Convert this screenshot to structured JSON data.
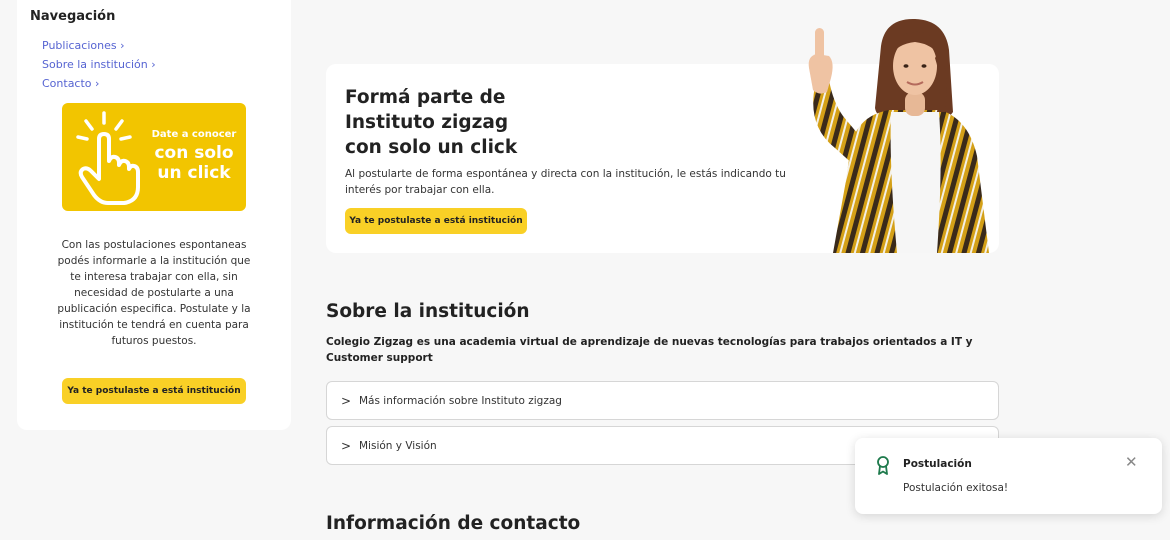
{
  "sidebar": {
    "title": "Navegación",
    "links": [
      {
        "label": "Publicaciones ›"
      },
      {
        "label": "Sobre la institución ›"
      },
      {
        "label": "Contacto ›"
      }
    ],
    "promo": {
      "line1": "Date a conocer",
      "line2": "con solo",
      "line3": "un click"
    },
    "description": "Con las postulaciones espontaneas podés informarle a la institución que te interesa trabajar con ella, sin necesidad de postularte a una publicación especifica. Postulate y la institución te tendrá en cuenta para futuros puestos.",
    "button_label": "Ya te postulaste a está institución"
  },
  "hero": {
    "title_lines": [
      "Formá parte de",
      "Instituto zigzag",
      "con solo un click"
    ],
    "description": "Al postularte de forma espontánea y directa con la institución, le estás indicando tu interés por trabajar con ella.",
    "button_label": "Ya te postulaste a está institución"
  },
  "about": {
    "title": "Sobre la institución",
    "description": "Colegio Zigzag es una academia virtual de aprendizaje de nuevas tecnologías para trabajos orientados a IT y Customer support",
    "accordions": [
      {
        "label": "Más información sobre Instituto zigzag"
      },
      {
        "label": "Misión y Visión"
      }
    ]
  },
  "contact": {
    "title": "Información de contacto"
  },
  "toast": {
    "title": "Postulación",
    "message": "Postulación exitosa!",
    "icon": "award-icon"
  },
  "colors": {
    "accent_yellow": "#f9d026",
    "link": "#5664d2",
    "toast_icon": "#1e7a4c"
  }
}
